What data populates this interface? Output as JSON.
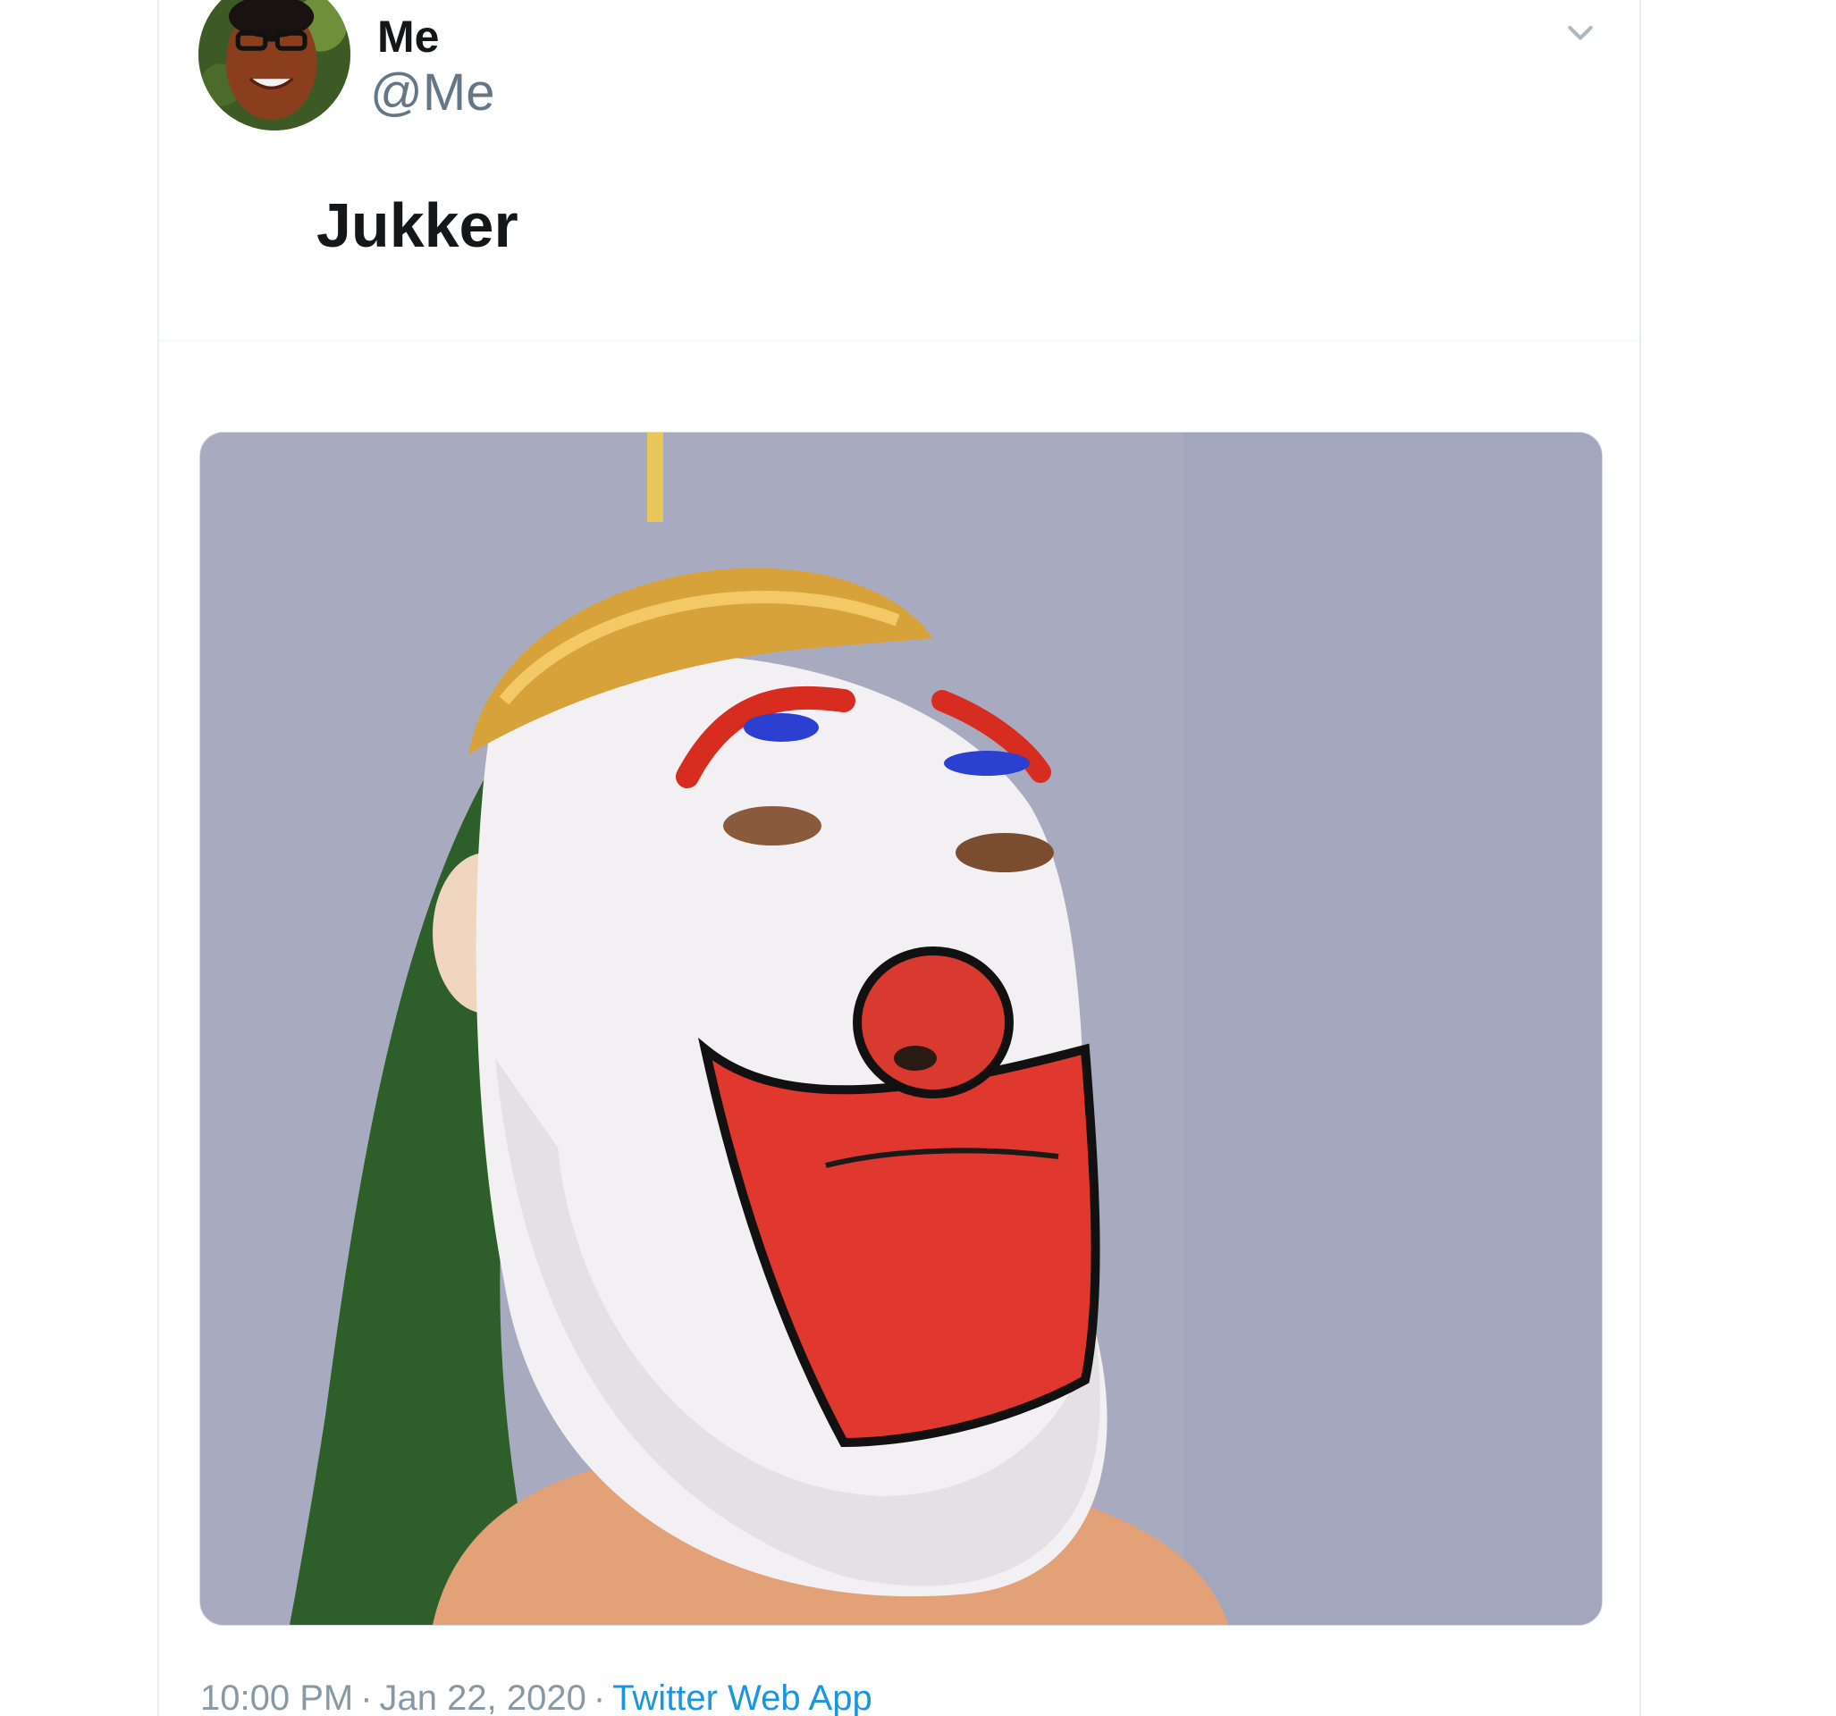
{
  "tweet": {
    "display_name": "Me",
    "handle": "@Me",
    "text": "Jukker",
    "timestamp": "10:00 PM",
    "separator": "·",
    "date": "Jan 22, 2020",
    "source": "Twitter Web App"
  },
  "icons": {
    "menu_caret": "chevron-down-icon",
    "avatar": "profile-photo"
  },
  "colors": {
    "text_primary": "#14171a",
    "text_secondary": "#657786",
    "link": "#1b95e0",
    "meta": "#8899a6"
  }
}
